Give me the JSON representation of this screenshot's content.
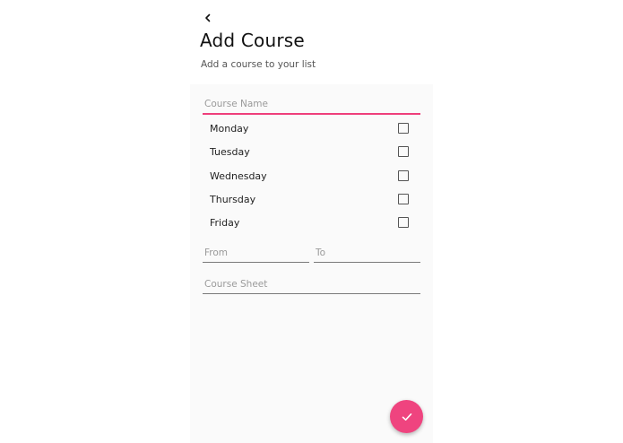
{
  "header": {
    "back_icon": "chevron-left-icon",
    "title": "Add Course",
    "subtitle": "Add a course to your list"
  },
  "form": {
    "course_name": {
      "placeholder": "Course Name",
      "value": ""
    },
    "days": [
      {
        "label": "Monday",
        "checked": false
      },
      {
        "label": "Tuesday",
        "checked": false
      },
      {
        "label": "Wednesday",
        "checked": false
      },
      {
        "label": "Thursday",
        "checked": false
      },
      {
        "label": "Friday",
        "checked": false
      }
    ],
    "from": {
      "placeholder": "From",
      "value": ""
    },
    "to": {
      "placeholder": "To",
      "value": ""
    },
    "course_sheet": {
      "placeholder": "Course Sheet",
      "value": ""
    }
  },
  "fab": {
    "icon": "check-icon"
  },
  "colors": {
    "accent": "#ee3f7b",
    "panel_background": "#fafafa",
    "page_background": "#ffffff"
  }
}
